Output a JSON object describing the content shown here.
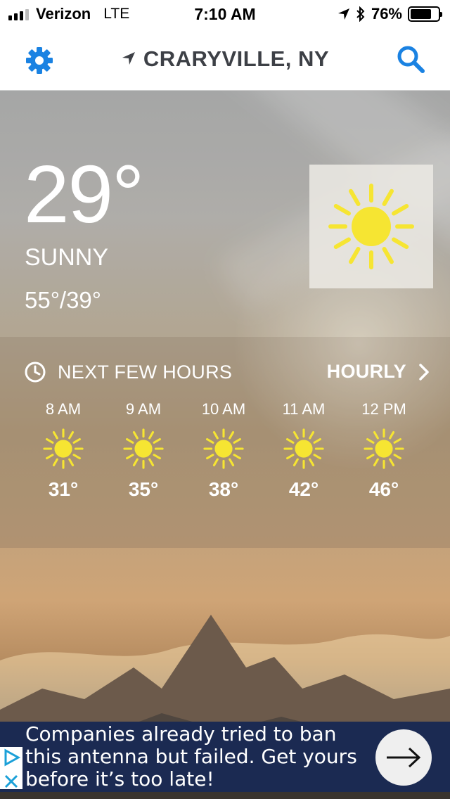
{
  "status": {
    "carrier": "Verizon",
    "network": "LTE",
    "time": "7:10 AM",
    "battery_percent": "76%",
    "battery_level": 0.76
  },
  "nav": {
    "location": "CRARYVILLE, NY",
    "settings_icon": "gear-icon",
    "search_icon": "search-icon",
    "location_icon": "location-arrow-icon",
    "accent_color": "#1a82e2"
  },
  "current": {
    "temperature": "29°",
    "condition": "SUNNY",
    "hi_lo": "55°/39°",
    "icon": "sun-icon",
    "sun_color": "#f6e532"
  },
  "hourly": {
    "heading": "NEXT FEW HOURS",
    "link_label": "HOURLY",
    "hours": [
      {
        "time": "8 AM",
        "temp": "31°",
        "icon": "sun-icon"
      },
      {
        "time": "9 AM",
        "temp": "35°",
        "icon": "sun-icon"
      },
      {
        "time": "10 AM",
        "temp": "38°",
        "icon": "sun-icon"
      },
      {
        "time": "11 AM",
        "temp": "42°",
        "icon": "sun-icon"
      },
      {
        "time": "12 PM",
        "temp": "46°",
        "icon": "sun-icon"
      }
    ]
  },
  "ad": {
    "text": "Companies already tried to ban this antenna but failed. Get yours before it’s too late!",
    "background_color": "#1b2a52"
  }
}
